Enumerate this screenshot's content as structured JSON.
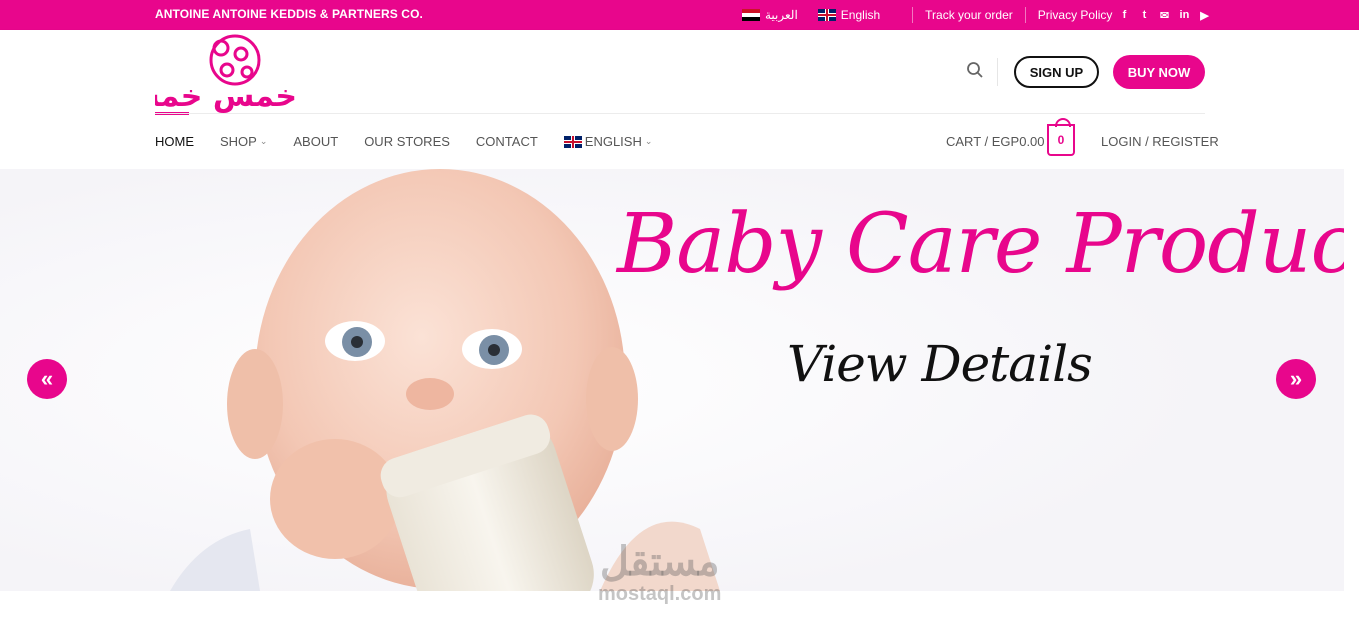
{
  "topbar": {
    "company": "ANTOINE ANTOINE KEDDIS & PARTNERS CO.",
    "lang_arabic": "العربية",
    "lang_english": "English",
    "track_order": "Track your order",
    "privacy": "Privacy Policy",
    "social": [
      "facebook-icon",
      "twitter-icon",
      "email-icon",
      "linkedin-icon",
      "youtube-icon"
    ],
    "social_glyphs": [
      "f",
      "t",
      "✉",
      "in",
      "▶"
    ]
  },
  "brand": {
    "logo_text": "خمس خمسات",
    "accent": "#e8068c"
  },
  "header": {
    "signup": "SIGN UP",
    "buy_now": "BUY NOW"
  },
  "nav": {
    "items": [
      {
        "label": "HOME",
        "active": true
      },
      {
        "label": "SHOP",
        "has_dropdown": true
      },
      {
        "label": "ABOUT"
      },
      {
        "label": "OUR STORES"
      },
      {
        "label": "CONTACT"
      },
      {
        "label": "ENGLISH",
        "has_dropdown": true,
        "flag": "uk-flag-icon"
      }
    ],
    "cart_label": "CART / EGP0.00",
    "cart_count": "0",
    "login": "LOGIN / REGISTER"
  },
  "hero": {
    "title": "Baby Care Product",
    "subtitle": "View Details"
  },
  "watermark": {
    "arabic": "مستقل",
    "latin": "mostaql.com"
  }
}
